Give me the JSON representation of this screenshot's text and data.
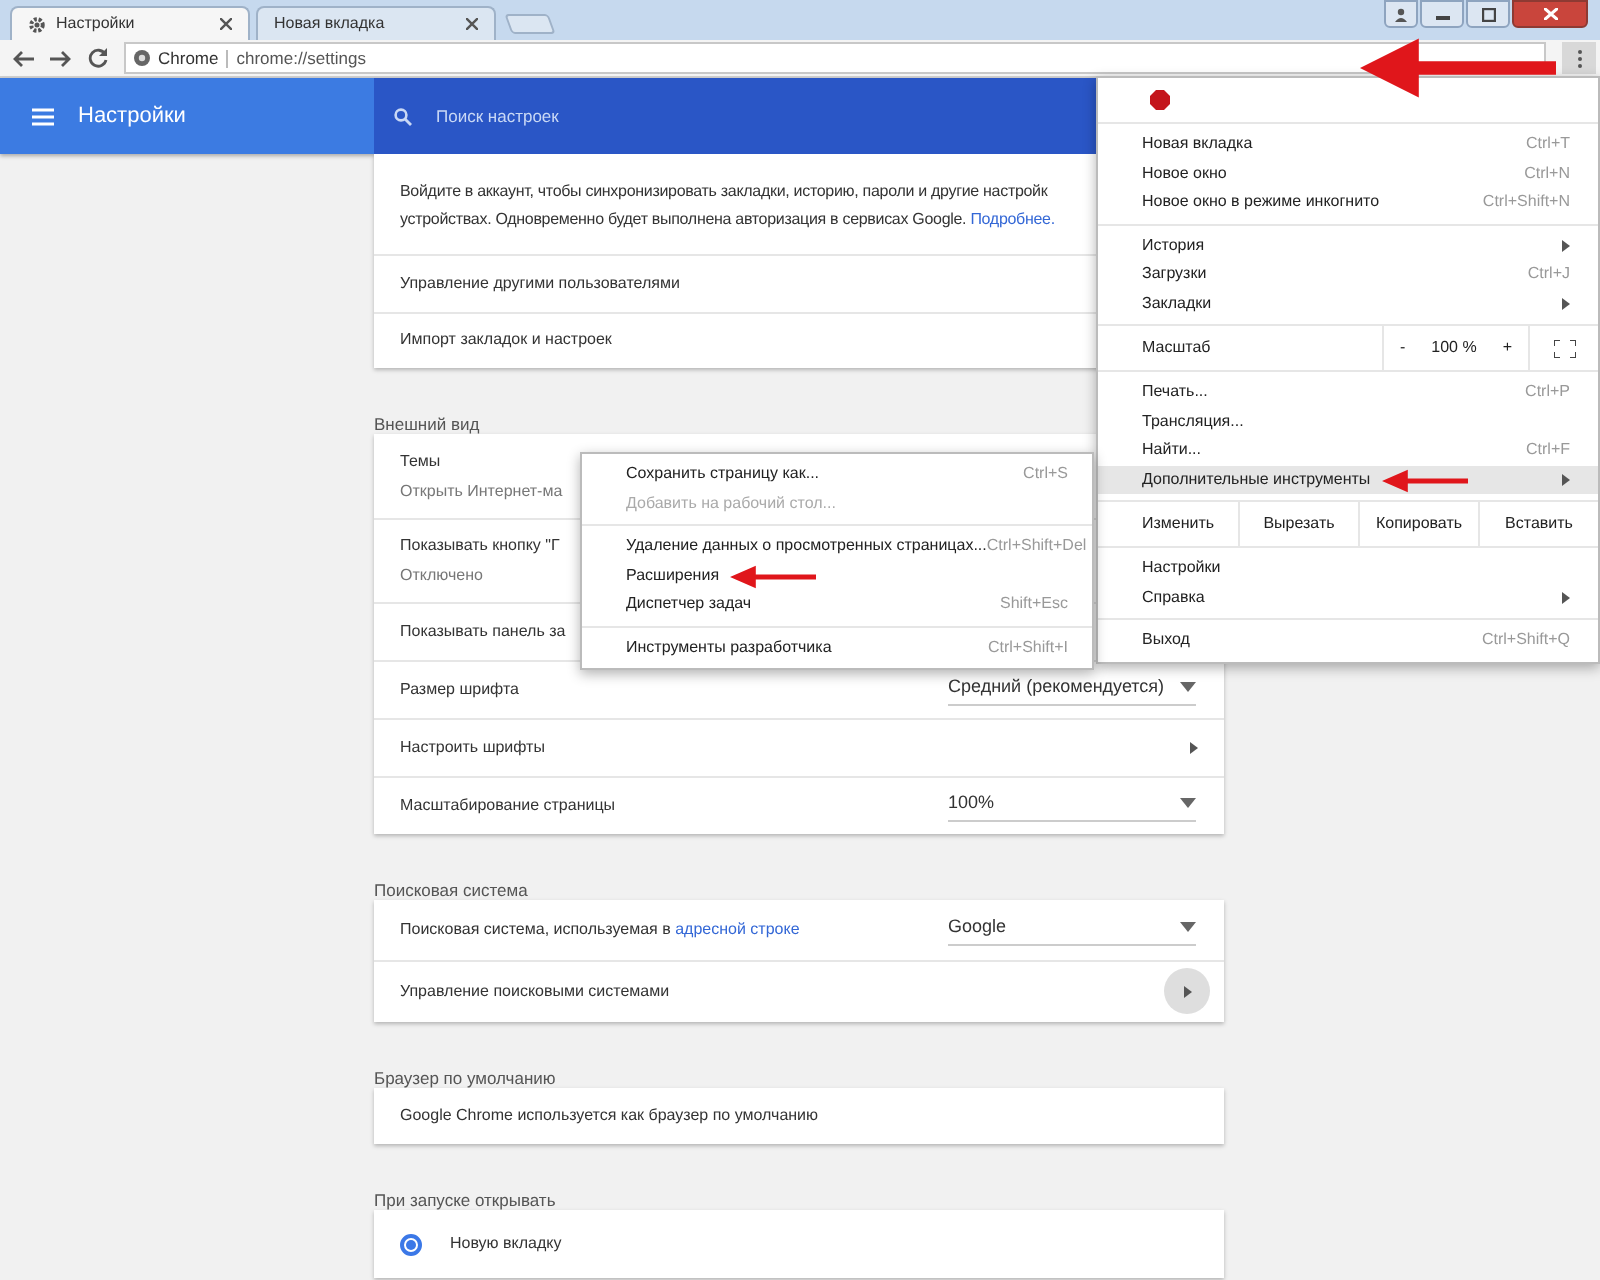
{
  "tabs": [
    {
      "title": "Настройки",
      "selected": true
    },
    {
      "title": "Новая вкладка",
      "selected": false
    }
  ],
  "omnibox": {
    "chip": "Chrome",
    "url": "chrome://settings"
  },
  "header": {
    "title": "Настройки",
    "search_placeholder": "Поиск настроек"
  },
  "cards": [
    {
      "intro": {
        "line1": "Войдите в аккаунт, чтобы синхронизировать закладки, историю, пароли и другие настройк",
        "line2": "устройствах. Одновременно будет выполнена авторизация в сервисах Google. ",
        "link": "Подробнее."
      },
      "rows": [
        {
          "kind": "plain",
          "label": "Управление другими пользователями"
        },
        {
          "kind": "plain",
          "label": "Импорт закладок и настроек"
        }
      ]
    },
    {
      "heading": "Внешний вид",
      "rows": [
        {
          "kind": "sub",
          "label": "Темы",
          "sub": "Открыть Интернет-ма"
        },
        {
          "kind": "sub",
          "label": "Показывать кнопку \"Г",
          "sub": "Отключено"
        },
        {
          "kind": "plain",
          "label": "Показывать панель за"
        },
        {
          "kind": "select",
          "label": "Размер шрифта",
          "value": "Средний (рекомендуется)"
        },
        {
          "kind": "arrow",
          "label": "Настроить шрифты"
        },
        {
          "kind": "select",
          "label": "Масштабирование страницы",
          "value": "100%"
        }
      ]
    },
    {
      "heading": "Поисковая система",
      "rows": [
        {
          "kind": "select",
          "label": "Поисковая система, используемая в ",
          "link": "адресной строке",
          "value": "Google"
        },
        {
          "kind": "round",
          "label": "Управление поисковыми системами"
        }
      ]
    },
    {
      "heading": "Браузер по умолчанию",
      "rows": [
        {
          "kind": "plain",
          "label": "Google Chrome используется как браузер по умолчанию"
        }
      ]
    },
    {
      "heading": "При запуске открывать",
      "rows": [
        {
          "kind": "radio",
          "label": "Новую вкладку",
          "selected": true
        }
      ]
    }
  ],
  "menu": [
    {
      "kind": "extension"
    },
    {
      "kind": "items",
      "items": [
        {
          "label": "Новая вкладка",
          "shortcut": "Ctrl+T"
        },
        {
          "label": "Новое окно",
          "shortcut": "Ctrl+N"
        },
        {
          "label": "Новое окно в режиме инкогнито",
          "shortcut": "Ctrl+Shift+N"
        }
      ]
    },
    {
      "kind": "items",
      "items": [
        {
          "label": "История",
          "submenu": true
        },
        {
          "label": "Загрузки",
          "shortcut": "Ctrl+J"
        },
        {
          "label": "Закладки",
          "submenu": true
        }
      ]
    },
    {
      "kind": "zoom",
      "label": "Масштаб",
      "minus": "-",
      "value": "100 %",
      "plus": "+"
    },
    {
      "kind": "items",
      "items": [
        {
          "label": "Печать...",
          "shortcut": "Ctrl+P"
        },
        {
          "label": "Трансляция..."
        },
        {
          "label": "Найти...",
          "shortcut": "Ctrl+F"
        },
        {
          "label": "Дополнительные инструменты",
          "submenu": true,
          "highlighted": true,
          "pointer": true
        }
      ]
    },
    {
      "kind": "edit",
      "label": "Изменить",
      "buttons": [
        "Вырезать",
        "Копировать",
        "Вставить"
      ]
    },
    {
      "kind": "items",
      "items": [
        {
          "label": "Настройки"
        },
        {
          "label": "Справка",
          "submenu": true
        }
      ]
    },
    {
      "kind": "items",
      "items": [
        {
          "label": "Выход",
          "shortcut": "Ctrl+Shift+Q"
        }
      ]
    }
  ],
  "submenu": [
    {
      "kind": "items",
      "items": [
        {
          "label": "Сохранить страницу как...",
          "shortcut": "Ctrl+S"
        },
        {
          "label": "Добавить на рабочий стол...",
          "disabled": true
        }
      ]
    },
    {
      "kind": "items",
      "items": [
        {
          "label": "Удаление данных о просмотренных страницах...",
          "shortcut": "Ctrl+Shift+Del"
        },
        {
          "label": "Расширения",
          "pointer": true
        },
        {
          "label": "Диспетчер задач",
          "shortcut": "Shift+Esc"
        }
      ]
    },
    {
      "kind": "items",
      "items": [
        {
          "label": "Инструменты разработчика",
          "shortcut": "Ctrl+Shift+I"
        }
      ]
    }
  ]
}
